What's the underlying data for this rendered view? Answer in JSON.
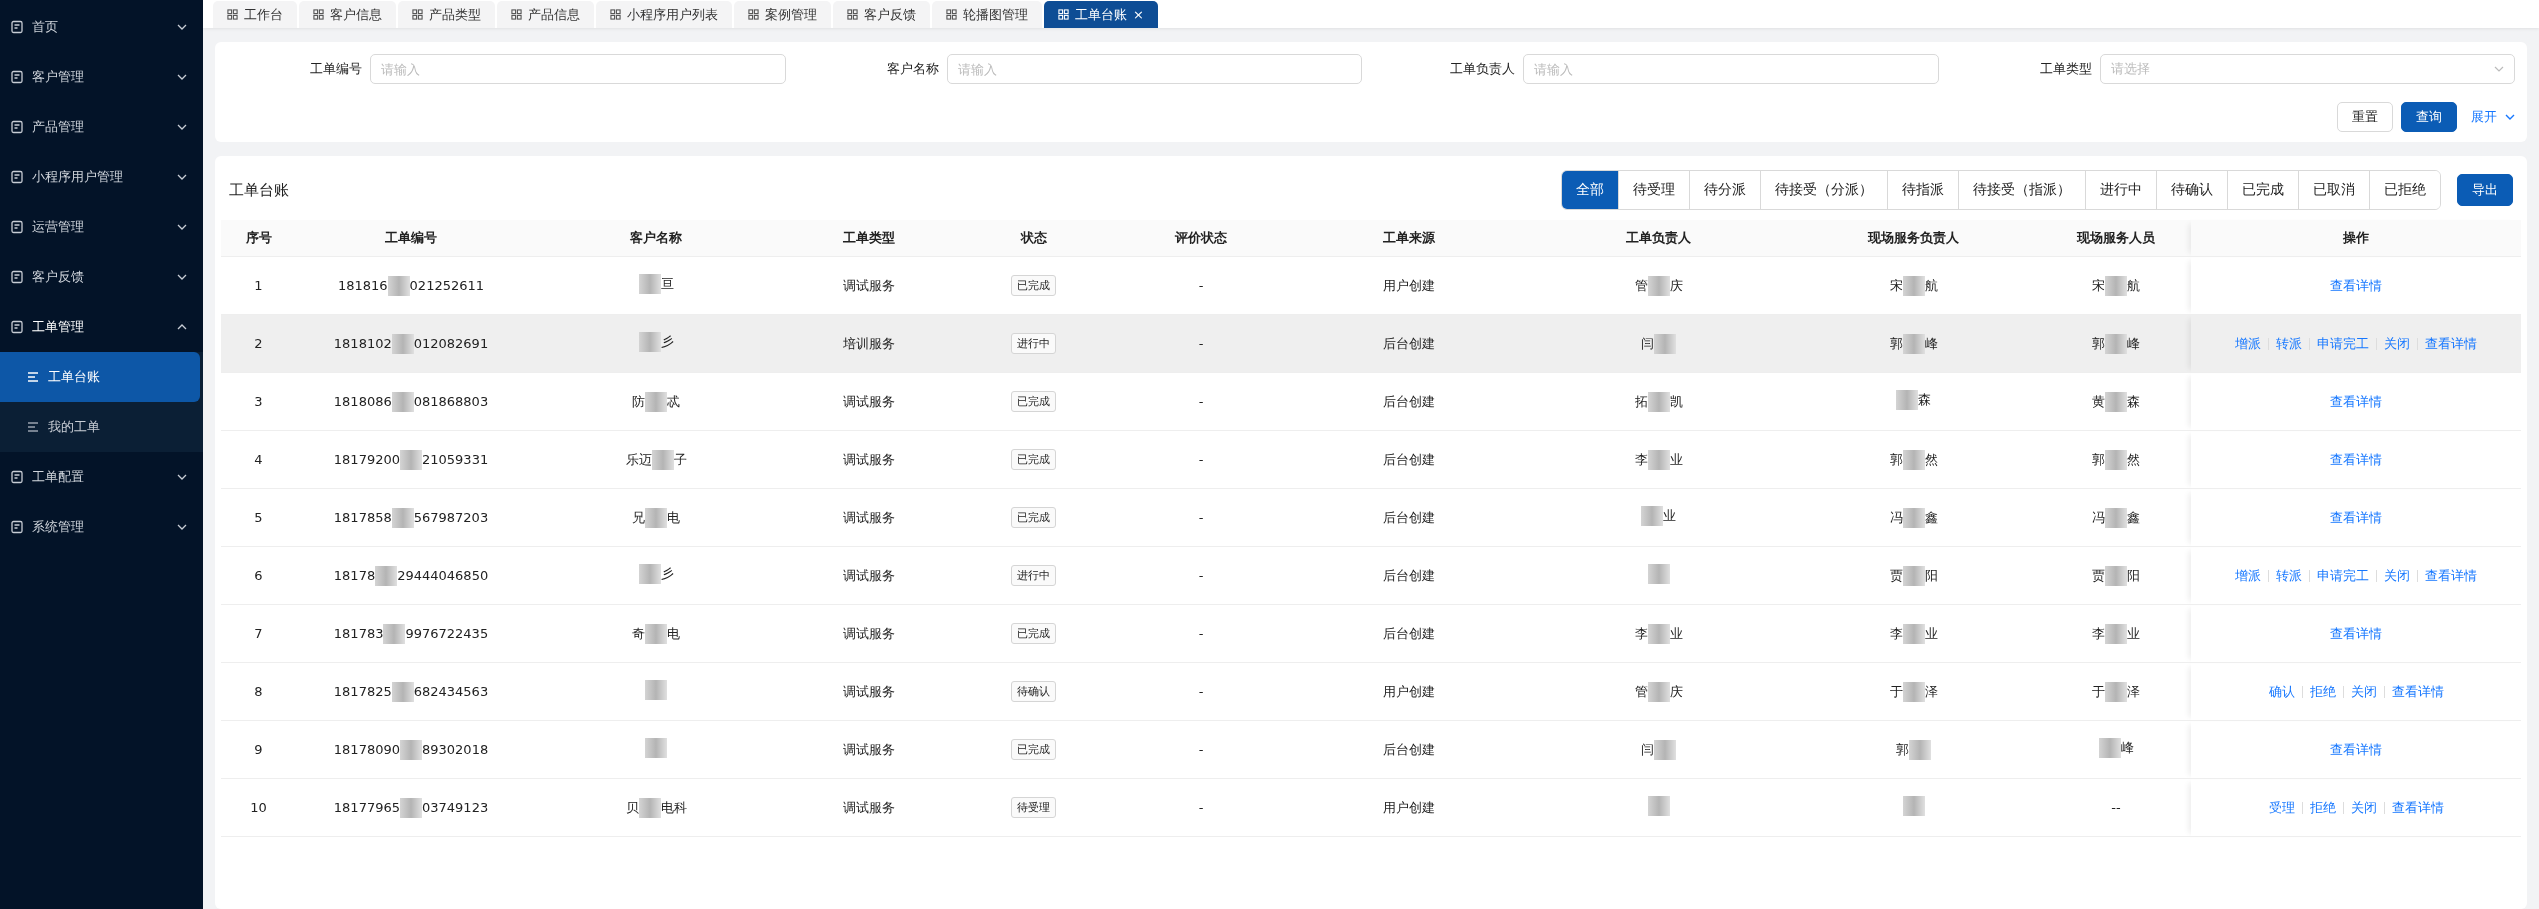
{
  "sidebar": {
    "items": [
      {
        "label": "首页",
        "expanded": false
      },
      {
        "label": "客户管理",
        "expanded": false
      },
      {
        "label": "产品管理",
        "expanded": false
      },
      {
        "label": "小程序用户管理",
        "expanded": false
      },
      {
        "label": "运营管理",
        "expanded": false
      },
      {
        "label": "客户反馈",
        "expanded": false
      },
      {
        "label": "工单管理",
        "expanded": true,
        "children": [
          {
            "label": "工单台账",
            "selected": true
          },
          {
            "label": "我的工单",
            "selected": false
          }
        ]
      },
      {
        "label": "工单配置",
        "expanded": false
      },
      {
        "label": "系统管理",
        "expanded": false
      }
    ]
  },
  "tabs": [
    {
      "label": "工作台",
      "selected": false
    },
    {
      "label": "客户信息",
      "selected": false
    },
    {
      "label": "产品类型",
      "selected": false
    },
    {
      "label": "产品信息",
      "selected": false
    },
    {
      "label": "小程序用户列表",
      "selected": false
    },
    {
      "label": "案例管理",
      "selected": false
    },
    {
      "label": "客户反馈",
      "selected": false
    },
    {
      "label": "轮播图管理",
      "selected": false
    },
    {
      "label": "工单台账",
      "selected": true,
      "close": "×"
    }
  ],
  "filters": {
    "fields": [
      {
        "label": "工单编号",
        "placeholder": "请输入",
        "kind": "input"
      },
      {
        "label": "客户名称",
        "placeholder": "请输入",
        "kind": "input"
      },
      {
        "label": "工单负责人",
        "placeholder": "请输入",
        "kind": "input"
      },
      {
        "label": "工单类型",
        "placeholder": "请选择",
        "kind": "select"
      }
    ],
    "reset": "重置",
    "query": "查询",
    "expand": "展开"
  },
  "table": {
    "title": "工单台账",
    "status_filters": [
      {
        "label": "全部",
        "selected": true
      },
      {
        "label": "待受理",
        "selected": false
      },
      {
        "label": "待分派",
        "selected": false
      },
      {
        "label": "待接受（分派）",
        "selected": false
      },
      {
        "label": "待指派",
        "selected": false
      },
      {
        "label": "待接受（指派）",
        "selected": false
      },
      {
        "label": "进行中",
        "selected": false
      },
      {
        "label": "待确认",
        "selected": false
      },
      {
        "label": "已完成",
        "selected": false
      },
      {
        "label": "已取消",
        "selected": false
      },
      {
        "label": "已拒绝",
        "selected": false
      }
    ],
    "export": "导出",
    "columns": [
      "序号",
      "工单编号",
      "客户名称",
      "工单类型",
      "状态",
      "评价状态",
      "工单来源",
      "工单负责人",
      "现场服务负责人",
      "现场服务人员",
      "操作"
    ],
    "rows": [
      {
        "hovered": false,
        "cells": [
          "1",
          {
            "before": "181816",
            "after": "021252611"
          },
          {
            "after": "亘"
          },
          "调试服务",
          "已完成",
          "-",
          "用户创建",
          {
            "before": "管",
            "after": "庆"
          },
          {
            "before": "宋",
            "after": "航"
          },
          {
            "before": "宋",
            "after": "航"
          }
        ],
        "actions": [
          "查看详情"
        ]
      },
      {
        "hovered": true,
        "cells": [
          "2",
          {
            "before": "1818102",
            "after": "012082691"
          },
          {
            "after": "彡"
          },
          "培训服务",
          "进行中",
          "-",
          "后台创建",
          {
            "before": "闫"
          },
          {
            "before": "郭",
            "after": "峰"
          },
          {
            "before": "郭",
            "after": "峰"
          }
        ],
        "actions": [
          "增派",
          "转派",
          "申请完工",
          "关闭",
          "查看详情"
        ]
      },
      {
        "hovered": false,
        "cells": [
          "3",
          {
            "before": "1818086",
            "after": "081868803"
          },
          {
            "before": "防",
            "after": "忒"
          },
          "调试服务",
          "已完成",
          "-",
          "后台创建",
          {
            "before": "拓",
            "after": "凯"
          },
          {
            "after": "森"
          },
          {
            "before": "黄",
            "after": "森"
          }
        ],
        "actions": [
          "查看详情"
        ]
      },
      {
        "hovered": false,
        "cells": [
          "4",
          {
            "before": "18179200",
            "after": "21059331"
          },
          {
            "before": "乐迈",
            "after": "子"
          },
          "调试服务",
          "已完成",
          "-",
          "后台创建",
          {
            "before": "李",
            "after": "业"
          },
          {
            "before": "郭",
            "after": "然"
          },
          {
            "before": "郭",
            "after": "然"
          }
        ],
        "actions": [
          "查看详情"
        ]
      },
      {
        "hovered": false,
        "cells": [
          "5",
          {
            "before": "1817858",
            "after": "567987203"
          },
          {
            "before": "兄",
            "after": "电"
          },
          "调试服务",
          "已完成",
          "-",
          "后台创建",
          {
            "after": "业"
          },
          {
            "before": "冯",
            "after": "鑫"
          },
          {
            "before": "冯",
            "after": "鑫"
          }
        ],
        "actions": [
          "查看详情"
        ]
      },
      {
        "hovered": false,
        "cells": [
          "6",
          {
            "before": "18178",
            "after": "29444046850"
          },
          {
            "after": "彡"
          },
          "调试服务",
          "进行中",
          "-",
          "后台创建",
          {},
          {
            "before": "贾",
            "after": "阳"
          },
          {
            "before": "贾",
            "after": "阳"
          }
        ],
        "actions": [
          "增派",
          "转派",
          "申请完工",
          "关闭",
          "查看详情"
        ]
      },
      {
        "hovered": false,
        "cells": [
          "7",
          {
            "before": "181783",
            "after": "9976722435"
          },
          {
            "before": "奇",
            "after": "电"
          },
          "调试服务",
          "已完成",
          "-",
          "后台创建",
          {
            "before": "李",
            "after": "业"
          },
          {
            "before": "李",
            "after": "业"
          },
          {
            "before": "李",
            "after": "业"
          }
        ],
        "actions": [
          "查看详情"
        ]
      },
      {
        "hovered": false,
        "cells": [
          "8",
          {
            "before": "1817825",
            "after": "682434563"
          },
          {},
          "调试服务",
          "待确认",
          "-",
          "用户创建",
          {
            "before": "管",
            "after": "庆"
          },
          {
            "before": "于",
            "after": "泽"
          },
          {
            "before": "于",
            "after": "泽"
          }
        ],
        "actions": [
          "确认",
          "拒绝",
          "关闭",
          "查看详情"
        ]
      },
      {
        "hovered": false,
        "cells": [
          "9",
          {
            "before": "18178090",
            "after": "89302018"
          },
          {},
          "调试服务",
          "已完成",
          "-",
          "后台创建",
          {
            "before": "闫"
          },
          {
            "before": "郭"
          },
          {
            "after": "峰"
          }
        ],
        "actions": [
          "查看详情"
        ]
      },
      {
        "hovered": false,
        "cells": [
          "10",
          {
            "before": "18177965",
            "after": "03749123"
          },
          {
            "before": "贝",
            "after": "电科"
          },
          "调试服务",
          "待受理",
          "-",
          "用户创建",
          {},
          {},
          "--"
        ],
        "actions": [
          "受理",
          "拒绝",
          "关闭",
          "查看详情"
        ]
      }
    ]
  }
}
